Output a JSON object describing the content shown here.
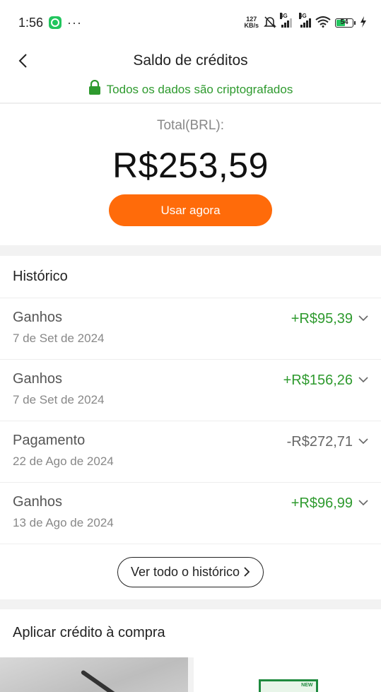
{
  "status_bar": {
    "time": "1:56",
    "dots": "···",
    "speed_value": "127",
    "speed_unit": "KB/s",
    "network_1": "4G",
    "network_2": "4G",
    "battery": "54"
  },
  "header": {
    "title": "Saldo de créditos"
  },
  "secure_notice": {
    "text": "Todos os dados são criptografados"
  },
  "balance": {
    "label": "Total(BRL):",
    "amount": "R$253,59",
    "use_button": "Usar agora"
  },
  "history": {
    "title": "Histórico",
    "items": [
      {
        "type": "Ganhos",
        "date": "7 de Set de 2024",
        "amount": "+R$95,39",
        "tone": "positive"
      },
      {
        "type": "Ganhos",
        "date": "7 de Set de 2024",
        "amount": "+R$156,26",
        "tone": "positive"
      },
      {
        "type": "Pagamento",
        "date": "22 de Ago de 2024",
        "amount": "-R$272,71",
        "tone": "negative"
      },
      {
        "type": "Ganhos",
        "date": "13 de Ago de 2024",
        "amount": "+R$96,99",
        "tone": "positive"
      }
    ],
    "view_all": "Ver todo o histórico"
  },
  "apply": {
    "title": "Aplicar crédito à compra",
    "badge": "NEW"
  },
  "colors": {
    "accent": "#ff6b0a",
    "positive": "#2e9a2e",
    "negative": "#666666"
  }
}
